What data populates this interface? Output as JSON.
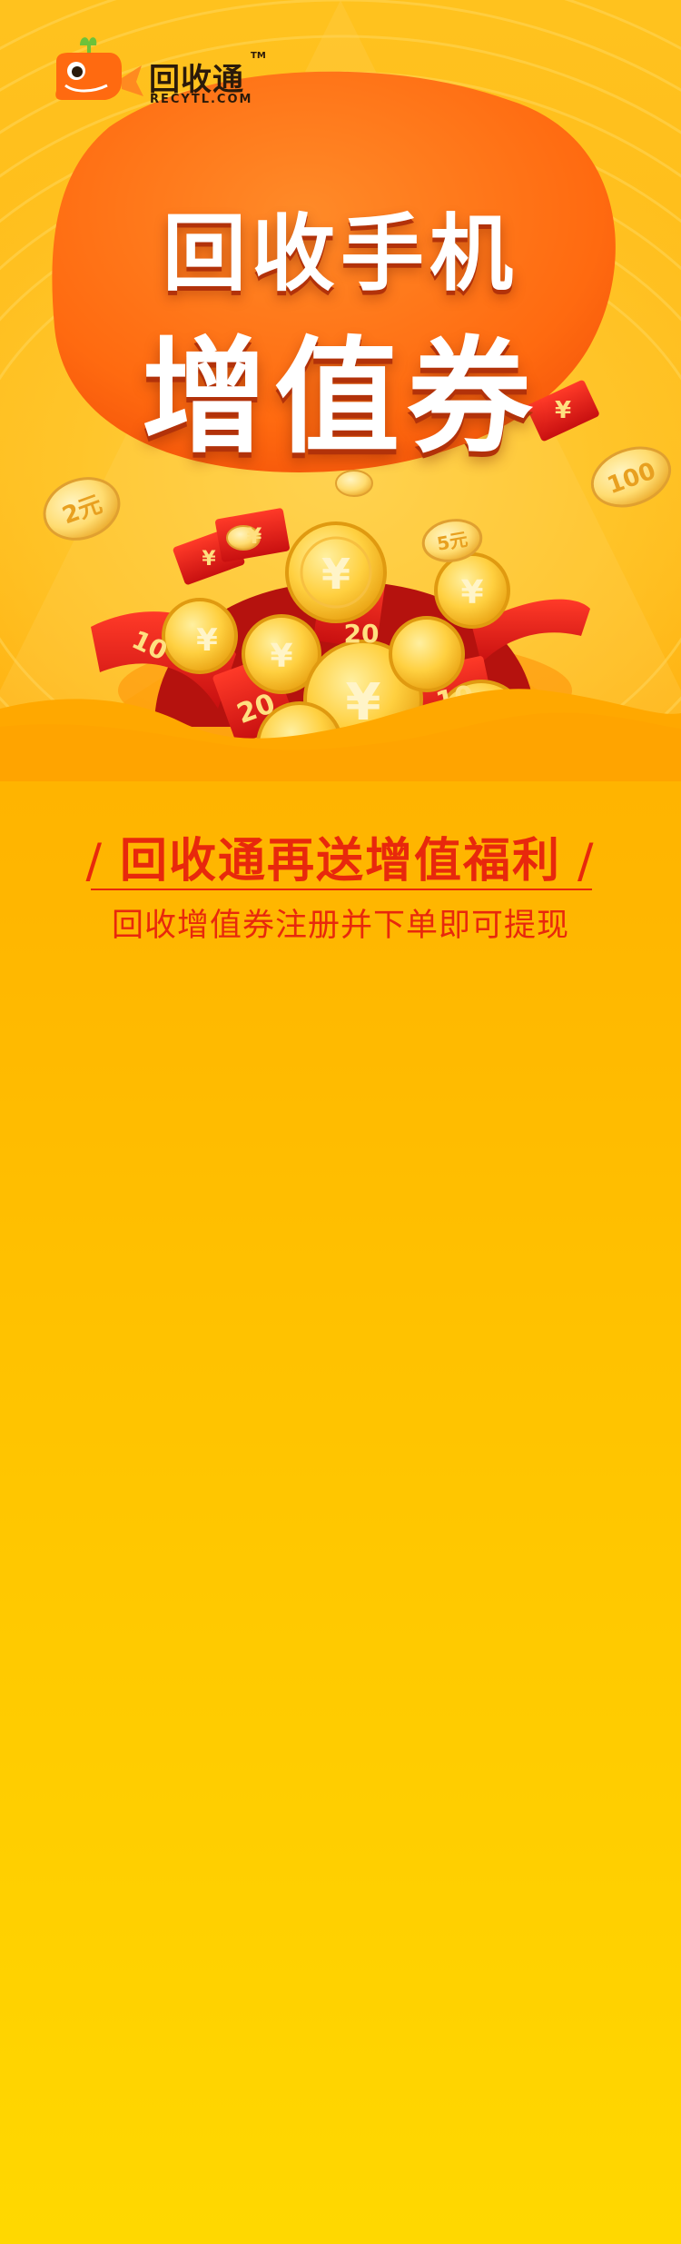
{
  "brand": {
    "name": "回收通",
    "domain": "RECYTL.COM",
    "trademark": "TM"
  },
  "hero": {
    "title_line1": "回收手机",
    "title_line2": "增值券"
  },
  "coins": {
    "symbol": "¥",
    "amounts": [
      "2元",
      "5元",
      "100",
      "10",
      "20",
      "20",
      "10"
    ]
  },
  "promo": {
    "headline": "回收通再送增值福利",
    "slash": "/",
    "subline": "回收增值券注册并下单即可提现"
  },
  "colors": {
    "accent_red": "#e8280c",
    "blob_orange": "#ff6a10",
    "coin_gold": "#ffd040",
    "envelope_red": "#e02020",
    "bg_top": "#ffa800",
    "bg_bottom": "#ffd800"
  }
}
